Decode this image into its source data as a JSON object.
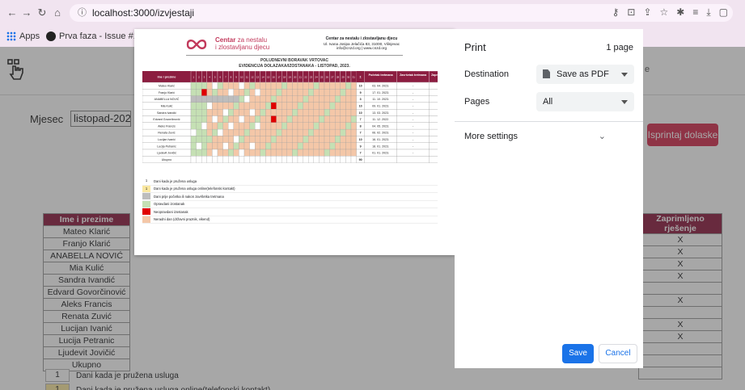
{
  "browser": {
    "url": "localhost:3000/izvjestaji",
    "bookmarks": [
      {
        "label": "Apps"
      },
      {
        "label": "Prva faza - Issue #1..."
      }
    ]
  },
  "page": {
    "month_label": "Mjesec",
    "month_value": "listopad-2023",
    "header_right_text": "e",
    "print_button": "Isprintaj dolaske",
    "table": {
      "header_name": "Ime i prezime",
      "header_decision": "Zaprimljeno rješenje",
      "rows": [
        {
          "name": "Mateo Klarić",
          "decision": "X"
        },
        {
          "name": "Franjo Klarić",
          "decision": "X"
        },
        {
          "name": "ANABELLA NOVIĆ",
          "decision": "X"
        },
        {
          "name": "Mia Kulić",
          "decision": "X"
        },
        {
          "name": "Sandra Ivandić",
          "decision": ""
        },
        {
          "name": "Edvard Govorčinović",
          "decision": "X"
        },
        {
          "name": "Aleks Francis",
          "decision": ""
        },
        {
          "name": "Renata Zuvić",
          "decision": "X"
        },
        {
          "name": "Lucijan Ivanić",
          "decision": "X"
        },
        {
          "name": "Lucija Petranic",
          "decision": ""
        },
        {
          "name": "Ljudevit Jovičić",
          "decision": ""
        },
        {
          "name": "Ukupno",
          "decision": ""
        }
      ]
    },
    "legend": [
      {
        "code": "1",
        "text": "Dani kada je pružena usluga",
        "color": "#ffffff"
      },
      {
        "code": "1",
        "text": "Dani kada je pružena usluga online(telefonski kontakt)",
        "color": "#f9e79f"
      }
    ]
  },
  "preview": {
    "brand_line1": "Centar",
    "brand_line1b": "za nestalu",
    "brand_line2": "i zlostavljanu djecu",
    "org_name": "Centar za nestalu i zlostavljanu djecu",
    "org_address": "Ul. Ivana Josipa Jelačića 83, 31000, Vilinjevac",
    "org_contact": "info@cnzd.org | www.cnzd.org",
    "title1": "POLUDNEVNI BORAVAK VRTOVAC",
    "title2": "EVIDENCIJA DOLAZAKA/IZOSTANAKA - LISTOPAD, 2023.",
    "col_name": "Ime i prezime",
    "col_total": "Σ",
    "col_start": "Početak tretmana",
    "col_end": "Završetak tretmana",
    "col_decision": "Zaprimljeno rješenje",
    "rows": [
      {
        "name": "Mateo Klarić",
        "total": "10",
        "start": "03. 04. 2023.",
        "end": "-",
        "decision": "X"
      },
      {
        "name": "Franjo Klarić",
        "total": "9",
        "start": "17. 01. 2023.",
        "end": "-",
        "decision": "X"
      },
      {
        "name": "ANABELLA NOVIĆ",
        "total": "3",
        "start": "11. 10. 2023.",
        "end": "-",
        "decision": "X"
      },
      {
        "name": "Mia Kulić",
        "total": "10",
        "start": "09. 01. 2023.",
        "end": "-",
        "decision": "X"
      },
      {
        "name": "Sandra Ivandić",
        "total": "10",
        "start": "13. 03. 2023.",
        "end": "-",
        "decision": ""
      },
      {
        "name": "Edvard Govorčinović",
        "total": "7",
        "start": "11. 12. 2022.",
        "end": "-",
        "decision": "X"
      },
      {
        "name": "Aleks Francis",
        "total": "8",
        "start": "04. 05. 2023.",
        "end": "-",
        "decision": ""
      },
      {
        "name": "Renata Zuvić",
        "total": "7",
        "start": "06. 02. 2023.",
        "end": "-",
        "decision": "X"
      },
      {
        "name": "Lucijan Ivanić",
        "total": "10",
        "start": "16. 01. 2023.",
        "end": "-",
        "decision": "X"
      },
      {
        "name": "Lucija Petranic",
        "total": "9",
        "start": "18. 01. 2023.",
        "end": "-",
        "decision": ""
      },
      {
        "name": "Ljudevit Jovičić",
        "total": "7",
        "start": "01. 01. 2023.",
        "end": "-",
        "decision": ""
      },
      {
        "name": "Ukupno",
        "total": "90",
        "start": "",
        "end": "",
        "decision": ""
      }
    ],
    "legend": [
      {
        "code": "1",
        "text": "Dani kada je pružena usluga",
        "color": "#ffffff"
      },
      {
        "code": "1",
        "text": "Dani kada je pružena usluga online(telefonski kontakt)",
        "color": "#f9e79f"
      },
      {
        "code": "",
        "text": "Dani prije početka ili nakon završetka tretmana",
        "color": "#bdbdbd"
      },
      {
        "code": "",
        "text": "Opravdani izostanak",
        "color": "#c5e0b4"
      },
      {
        "code": "",
        "text": "Neopravdani izostanak",
        "color": "#e00000"
      },
      {
        "code": "",
        "text": "Neradni dan (državni praznik, vikend)",
        "color": "#f4c7a8"
      }
    ]
  },
  "print_panel": {
    "title": "Print",
    "pages_count": "1 page",
    "destination_label": "Destination",
    "destination_value": "Save as PDF",
    "pages_label": "Pages",
    "pages_value": "All",
    "more_settings": "More settings",
    "save": "Save",
    "cancel": "Cancel"
  }
}
